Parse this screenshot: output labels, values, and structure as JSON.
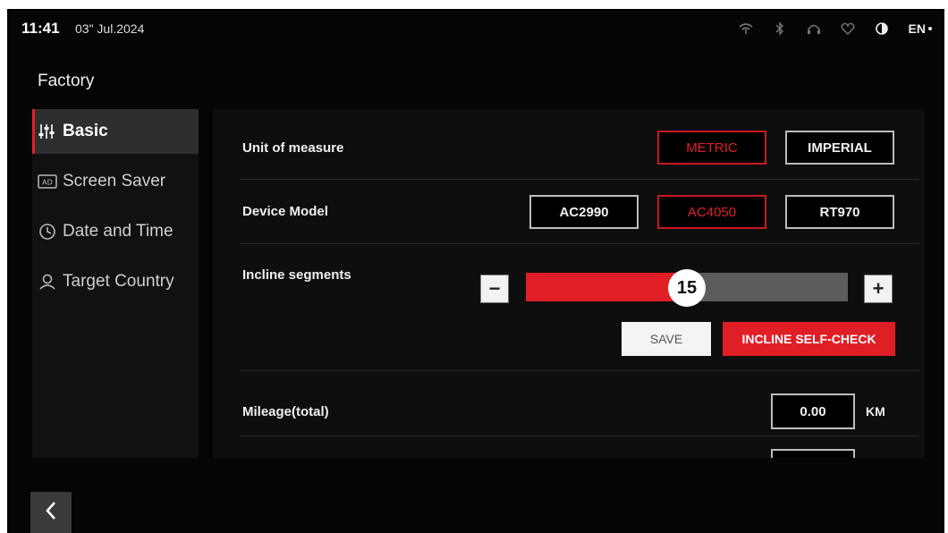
{
  "status_bar": {
    "time": "11:41",
    "date": "03\" Jul.2024",
    "language": "EN"
  },
  "page_title": "Factory",
  "sidebar": {
    "items": [
      {
        "label": "Basic",
        "icon": "sliders-icon",
        "active": true
      },
      {
        "label": "Screen Saver",
        "icon": "ad-screen-icon",
        "active": false
      },
      {
        "label": "Date and Time",
        "icon": "clock-icon",
        "active": false
      },
      {
        "label": "Target Country",
        "icon": "location-pin-icon",
        "active": false
      }
    ]
  },
  "settings": {
    "unit_of_measure": {
      "label": "Unit of measure",
      "options": [
        "METRIC",
        "IMPERIAL"
      ],
      "selected": "METRIC"
    },
    "device_model": {
      "label": "Device Model",
      "options": [
        "AC2990",
        "AC4050",
        "RT970"
      ],
      "selected": "AC4050"
    },
    "incline_segments": {
      "label": "Incline segments",
      "value": "15",
      "minus_label": "−",
      "plus_label": "+",
      "fill_fraction": 0.5
    },
    "save_label": "SAVE",
    "self_check_label": "INCLINE SELF-CHECK",
    "mileage": {
      "label": "Mileage(total)",
      "value": "0.00",
      "unit": "KM"
    }
  },
  "colors": {
    "accent": "#e01e26",
    "background": "#050505",
    "panel": "#0e0e0e"
  }
}
